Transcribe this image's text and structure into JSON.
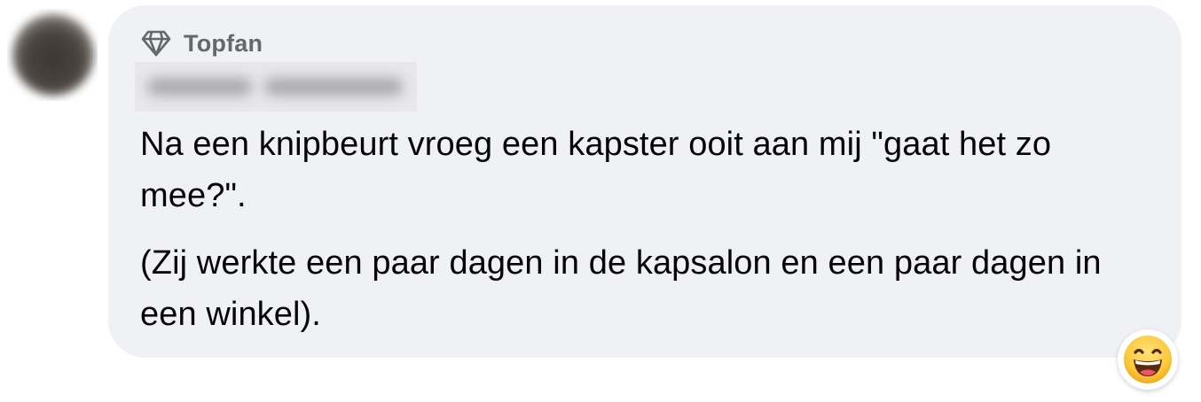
{
  "comment": {
    "badge": {
      "icon": "diamond-icon",
      "label": "Topfan"
    },
    "author_name": "",
    "paragraphs": [
      "Na een knipbeurt vroeg een kapster ooit aan mij \"gaat het zo mee?\".",
      "(Zij werkte een paar dagen in de kapsalon en een paar dagen in een winkel)."
    ],
    "reaction": {
      "icon": "haha-emoji-icon"
    }
  },
  "colors": {
    "bubble_background": "#f0f1f5",
    "badge_text": "#65676b",
    "body_text": "#050505",
    "emoji_face": "#fcc93b"
  }
}
